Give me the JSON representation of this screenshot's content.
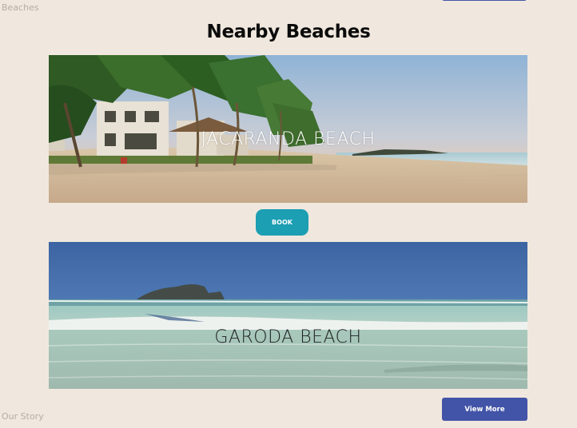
{
  "nav": {
    "beaches_label": "Beaches",
    "our_story_label": "Our Story"
  },
  "section": {
    "title": "Nearby Beaches"
  },
  "beaches": [
    {
      "name": "JACARANDA BEACH"
    },
    {
      "name": "GARODA BEACH"
    }
  ],
  "actions": {
    "book_label": "BOOK",
    "view_more_label": "View More"
  },
  "colors": {
    "page_background": "#f0e8de",
    "book_button": "#1c9eb3",
    "view_more_button": "#4254a7"
  }
}
